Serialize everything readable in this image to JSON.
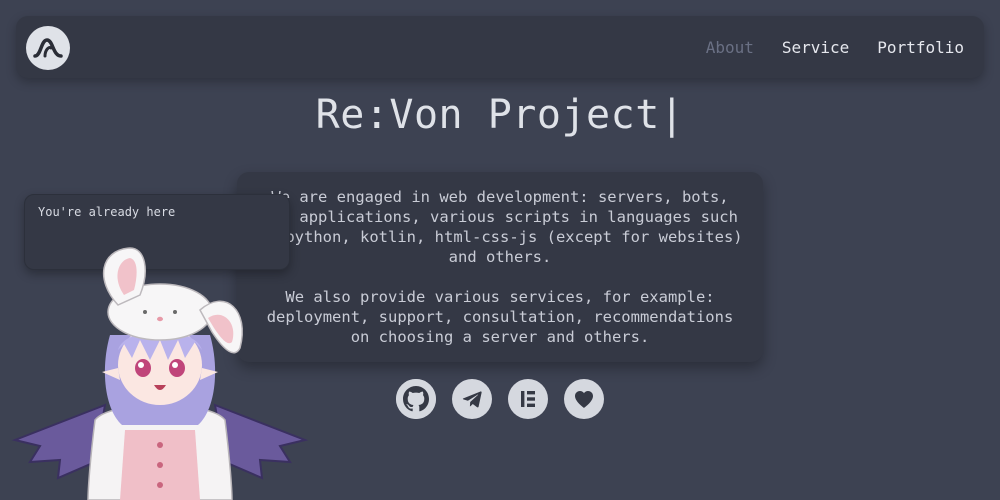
{
  "header": {
    "logo_icon": "wave-logo-icon",
    "nav": [
      {
        "label": "About",
        "active": true
      },
      {
        "label": "Service",
        "active": false
      },
      {
        "label": "Portfolio",
        "active": false
      }
    ]
  },
  "title": {
    "text": "Re:Von Project",
    "cursor": "|"
  },
  "description": {
    "paragraph1": "We are engaged in web development: servers, bots, web applications, various scripts in languages such as python, kotlin, html-css-js (except for websites) and others.",
    "paragraph2": "We also provide various services, for example: deployment, support, consultation, recommendations on choosing a server and others."
  },
  "social": [
    {
      "icon": "github-icon"
    },
    {
      "icon": "telegram-icon"
    },
    {
      "icon": "elementor-icon"
    },
    {
      "icon": "heart-icon"
    }
  ],
  "tooltip": {
    "text": "You're already here"
  },
  "colors": {
    "background": "#3d4252",
    "panel": "#343845",
    "active_nav": "#6a7084",
    "icon_fill": "#d5d8df"
  }
}
